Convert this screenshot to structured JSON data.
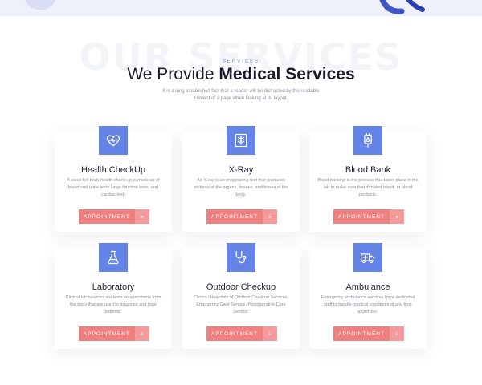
{
  "section": {
    "background_word": "OUR SERVICES",
    "eyebrow": "SERVICES",
    "heading_light": "We Provide",
    "heading_strong": "Medical Services",
    "intro": "It is a long established fact that a reader will be distracted by the readable content of a page when looking at its layout."
  },
  "button": {
    "label": "APPOINTMENT",
    "plus": "+"
  },
  "cards": [
    {
      "title": "Health CheckUp",
      "text": "A usual full-body health check-up is made up of blood and urine tests lungs function tests, and cardiac test.",
      "icon": "heart-pulse-icon"
    },
    {
      "title": "X-Ray",
      "text": "An X-ray is an imaginaring test that produces pictures of the organs, tissues, and bones of the body.",
      "icon": "xray-icon"
    },
    {
      "title": "Blood Bank",
      "text": "Blood banking is the process that takes place in the lab to make sure that donated blood, or blood products.",
      "icon": "blood-bag-icon"
    },
    {
      "title": "Laboratory",
      "text": "Clinical lab services are tests on specimens from the body that are used to diagnose and treat patients.",
      "icon": "flask-icon"
    },
    {
      "title": "Outdoor Checkup",
      "text": "Clinics / Hospitals of Outdoor Checkup Services, Emergency Care Service, Postoperative Care Service.",
      "icon": "stethoscope-icon"
    },
    {
      "title": "Ambulance",
      "text": "Emergency ambulance services have dedicated staff to handle medical conditions at any time anywhere.",
      "icon": "ambulance-icon"
    }
  ],
  "colors": {
    "accent": "#6383e6",
    "button": "#f07f7f",
    "button_plus": "#f49a9a"
  }
}
